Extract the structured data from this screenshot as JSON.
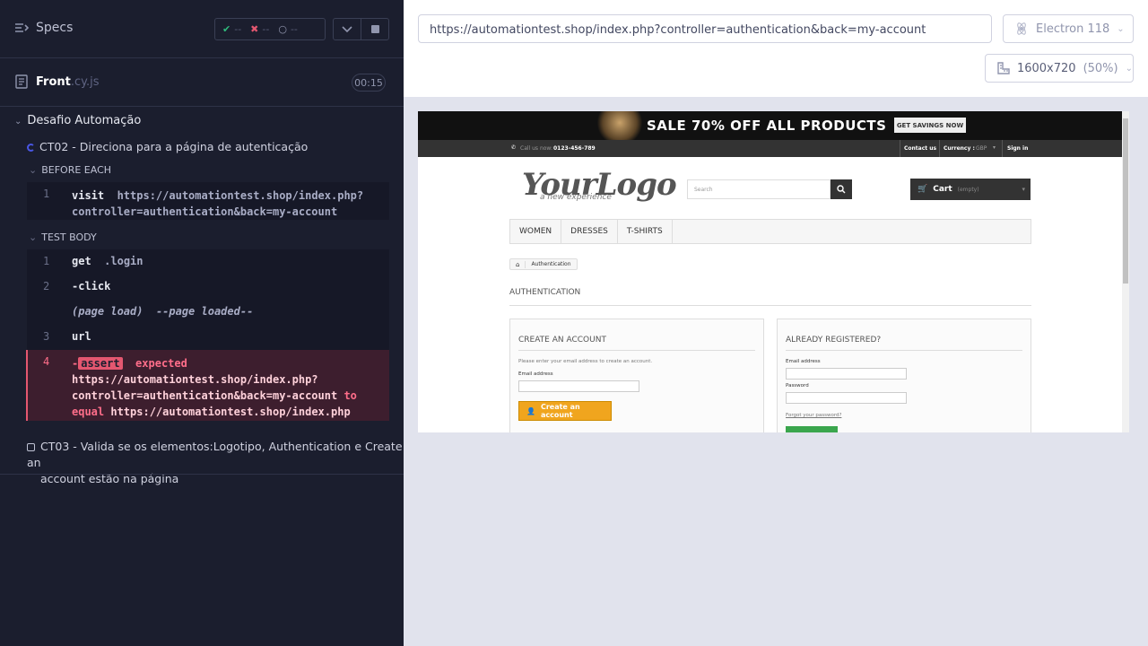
{
  "reporter": {
    "specs_label": "Specs",
    "stats": {
      "passed": "--",
      "failed": "--",
      "pending": "--"
    },
    "file": {
      "name": "Front",
      "ext": ".cy.js",
      "duration": "00:15"
    },
    "suite": {
      "title": "Desafio Automação",
      "tests": [
        {
          "title": "CT02 - Direciona para a página de autenticação"
        },
        {
          "title_line1": "CT03 - Valida se os elementos:Logotipo, Authentication e Create an",
          "title_line2": "account estão na página"
        }
      ]
    },
    "before_each": {
      "label": "BEFORE EACH",
      "commands": [
        {
          "num": "1",
          "name": "visit",
          "arg_line1": "https://automationtest.shop/index.php?",
          "arg_line2": "controller=authentication&back=my-account"
        }
      ]
    },
    "test_body": {
      "label": "TEST BODY",
      "commands": [
        {
          "num": "1",
          "name": "get",
          "arg": ".login"
        },
        {
          "num": "2",
          "name": "-click"
        },
        {
          "event": "(page load)",
          "event_arg": "--page loaded--"
        },
        {
          "num": "3",
          "name": "url"
        },
        {
          "num": "4",
          "dash": "-",
          "badge": "assert",
          "expected": "expected",
          "line2": "https://automationtest.shop/index.php?",
          "line3": "controller=authentication&back=my-account",
          "to": "to",
          "equal": "equal",
          "line4": "https://automationtest.shop/index.php"
        }
      ]
    }
  },
  "browser_bar": {
    "url": "https://automationtest.shop/index.php?controller=authentication&back=my-account",
    "browser": "Electron 118",
    "viewport": "1600x720",
    "scale": "(50%)"
  },
  "aut": {
    "banner_text": "SALE 70% OFF ALL PRODUCTS",
    "banner_button": "GET SAVINGS NOW",
    "call_label": "Call us now:",
    "phone": "0123-456-789",
    "contact": "Contact us",
    "currency_label": "Currency :",
    "currency_value": "GBP",
    "sign_in": "Sign in",
    "logo_text": "YourLogo",
    "logo_sub": "a new experience",
    "search_placeholder": "Search",
    "cart_label": "Cart",
    "cart_status": "(empty)",
    "menu": [
      "WOMEN",
      "DRESSES",
      "T-SHIRTS"
    ],
    "breadcrumb": "Authentication",
    "page_heading": "AUTHENTICATION",
    "create": {
      "title": "CREATE AN ACCOUNT",
      "hint": "Please enter your email address to create an account.",
      "email_label": "Email address",
      "button": "Create an account"
    },
    "registered": {
      "title": "ALREADY REGISTERED?",
      "email_label": "Email address",
      "password_label": "Password",
      "forgot": "Forgot your password?"
    }
  },
  "colors": {
    "reporter_bg": "#1b1e2e",
    "failed_bg": "#3d1e2e",
    "failed_accent": "#e45770",
    "create_button": "#f0a51e"
  }
}
